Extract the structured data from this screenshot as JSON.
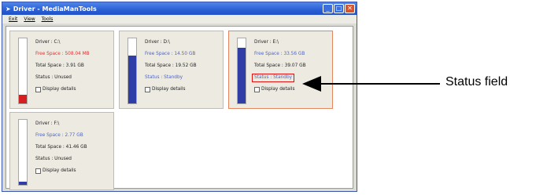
{
  "window": {
    "title": "Driver - MediaManTools",
    "controls": {
      "minimize": "_",
      "maximize": "□",
      "close": "✕"
    },
    "icon": "app-icon"
  },
  "menu": [
    "Exit",
    "View",
    "Tools"
  ],
  "drives": [
    {
      "driver": "Driver : C:\\",
      "free_space": "Free Space : 508.04 MB",
      "total_space": "Total Space : 3.91 GB",
      "status": "Status : Unused",
      "display_details": "Display details",
      "used_fraction": 0.13,
      "fill_color": "#d42020"
    },
    {
      "driver": "Driver : D:\\",
      "free_space": "Free Space : 14.50 GB",
      "total_space": "Total Space : 19.52 GB",
      "status": "Status : Standby",
      "display_details": "Display details",
      "used_fraction": 0.74,
      "fill_color": "#2f3ea6"
    },
    {
      "driver": "Driver : E:\\",
      "free_space": "Free Space : 33.56 GB",
      "total_space": "Total Space : 39.07 GB",
      "status": "Status : Standby",
      "display_details": "Display details",
      "used_fraction": 0.86,
      "fill_color": "#2f3ea6"
    },
    {
      "driver": "Driver : F:\\",
      "free_space": "Free Space : 2.77 GB",
      "total_space": "Total Space : 41.46 GB",
      "status": "Status : Unused",
      "display_details": "Display details",
      "used_fraction": 0.05,
      "fill_color": "#2f3ea6"
    }
  ],
  "annotation": {
    "label": "Status field"
  }
}
